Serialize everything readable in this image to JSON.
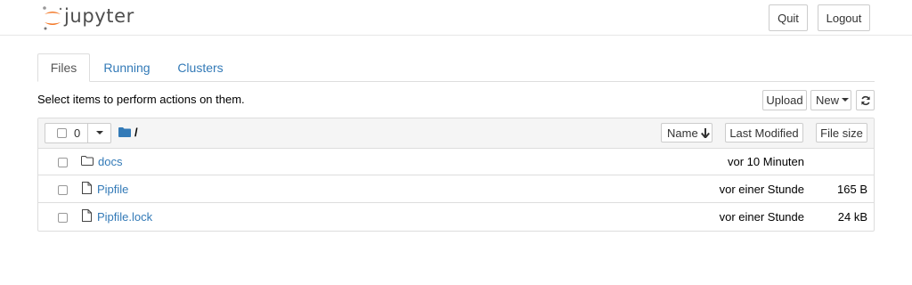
{
  "header": {
    "logo_text": "jupyter",
    "quit_label": "Quit",
    "logout_label": "Logout"
  },
  "tabs": [
    {
      "label": "Files"
    },
    {
      "label": "Running"
    },
    {
      "label": "Clusters"
    }
  ],
  "toolbar": {
    "hint": "Select items to perform actions on them.",
    "upload_label": "Upload",
    "new_label": "New",
    "refresh_icon": "refresh-icon"
  },
  "list_header": {
    "selected_count": "0",
    "breadcrumb": "/",
    "sort_name_label": "Name",
    "last_modified_label": "Last Modified",
    "file_size_label": "File size"
  },
  "files": [
    {
      "name": "docs",
      "type": "folder",
      "modified": "vor 10 Minuten",
      "size": ""
    },
    {
      "name": "Pipfile",
      "type": "file",
      "modified": "vor einer Stunde",
      "size": "165 B"
    },
    {
      "name": "Pipfile.lock",
      "type": "file",
      "modified": "vor einer Stunde",
      "size": "24 kB"
    }
  ],
  "colors": {
    "link": "#337ab7",
    "jupyter_orange": "#f37726"
  }
}
